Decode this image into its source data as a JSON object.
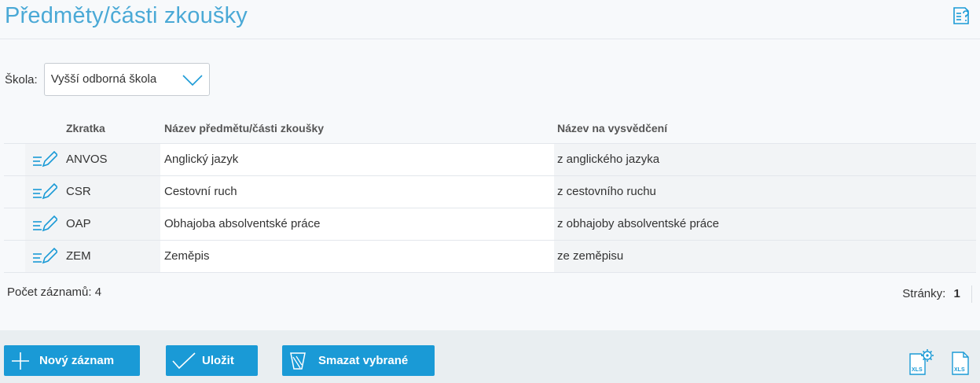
{
  "header": {
    "title": "Předměty/části zkoušky",
    "help_icon": "document-help-icon"
  },
  "filter": {
    "label": "Škola:",
    "selected": "Vyšší odborná škola"
  },
  "table": {
    "columns": [
      "Zkratka",
      "Název předmětu/části zkoušky",
      "Název na vysvědčení"
    ],
    "rows": [
      {
        "code": "ANVOS",
        "name": "Anglický jazyk",
        "certificate_name": "z anglického jazyka"
      },
      {
        "code": "CSR",
        "name": "Cestovní ruch",
        "certificate_name": "z cestovního ruchu"
      },
      {
        "code": "OAP",
        "name": "Obhajoba absolventské práce",
        "certificate_name": "z obhajoby absolventské práce"
      },
      {
        "code": "ZEM",
        "name": "Zeměpis",
        "certificate_name": "ze zeměpisu"
      }
    ]
  },
  "footer": {
    "count_label": "Počet záznamů: 4",
    "pages_label": "Stránky:",
    "current_page": "1"
  },
  "toolbar": {
    "new_label": "Nový záznam",
    "save_label": "Uložit",
    "delete_label": "Smazat vybrané",
    "xls_label": "XLS"
  },
  "colors": {
    "accent": "#1a9ad6",
    "title": "#4aa9d6",
    "toolbar_bg": "#e9eef1"
  }
}
